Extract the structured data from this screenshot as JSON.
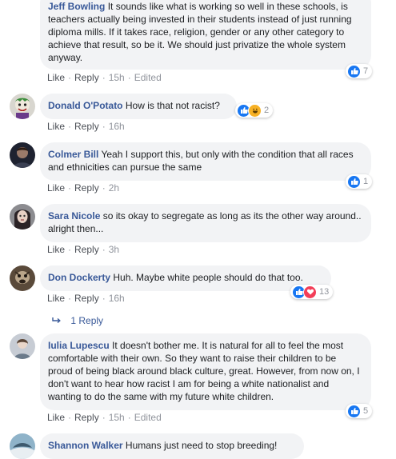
{
  "actions": {
    "like": "Like",
    "reply": "Reply",
    "sep": "·",
    "edited": "Edited"
  },
  "comments": [
    {
      "author": "Jeff Bowling",
      "text": "It sounds like what is working so well in these schools, is teachers actually being invested in their students instead of just running diploma mills. If it takes race, religion, gender or any other category to achieve that result, so be it. We should just privatize the whole system anyway.",
      "time": "15h",
      "edited": true,
      "reactions": "7"
    },
    {
      "author": "Donald O'Potato",
      "text": "How is that not racist?",
      "time": "16h",
      "reactions": "2"
    },
    {
      "author": "Colmer Bill",
      "text": "Yeah I support this, but only with the condition that all races and ethnicities can pursue the same",
      "time": "2h",
      "reactions": "1"
    },
    {
      "author": "Sara Nicole",
      "text": "so its okay to segregate as long as its the other way around.. alright then...",
      "time": "3h"
    },
    {
      "author": "Don Dockerty",
      "text": "Huh. Maybe white people should do that too.",
      "time": "16h",
      "reactions": "13"
    },
    {
      "author": "Iulia Lupescu",
      "text": "It doesn't bother me. It is natural for all to feel the most comfortable with their own. So they want to raise their children to be proud of being black around black culture, great. However, from now on, I don't want to hear how racist I am for being a white nationalist and wanting to do the same with my future white children.",
      "time": "15h",
      "edited": true,
      "reactions": "5"
    },
    {
      "author": "Shannon Walker",
      "text": "Humans just need to stop breeding!"
    }
  ],
  "replies_link": "1 Reply",
  "colors": {
    "bubble": "#f2f3f5",
    "author": "#385898",
    "like_blue": "#1877f2",
    "love_red": "#f33e58",
    "haha_yellow": "#f7b125"
  }
}
